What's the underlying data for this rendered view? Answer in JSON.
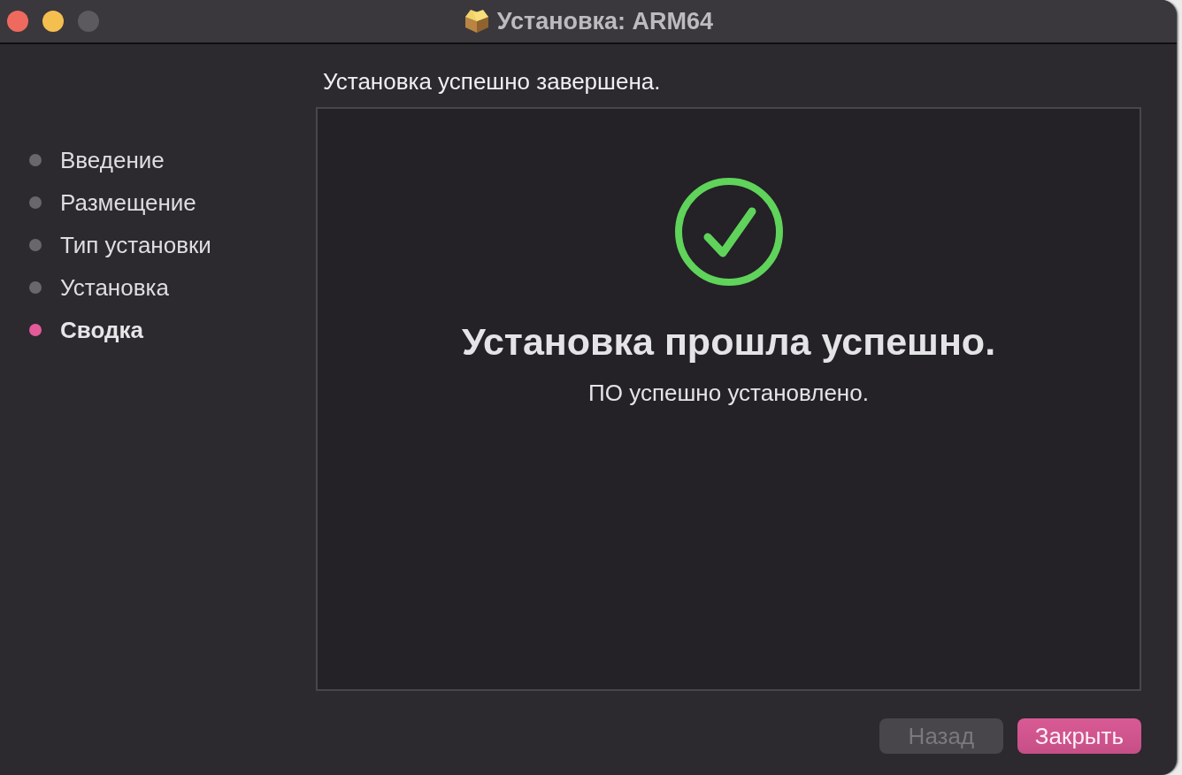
{
  "window": {
    "title": "Установка: ARM64",
    "controls": [
      {
        "kind": "close",
        "disabled": false
      },
      {
        "kind": "minimize",
        "disabled": false
      },
      {
        "kind": "zoom",
        "disabled": true
      }
    ]
  },
  "steps": [
    {
      "label": "Введение",
      "selected": false
    },
    {
      "label": "Размещение",
      "selected": false
    },
    {
      "label": "Тип установки",
      "selected": false
    },
    {
      "label": "Установка",
      "selected": false
    },
    {
      "label": "Сводка",
      "selected": true
    }
  ],
  "heading": "Установка успешно завершена.",
  "result": {
    "title": "Установка прошла успешно.",
    "message": "ПО успешно установлено."
  },
  "buttons": [
    {
      "label": "Назад",
      "kind": "secondary",
      "disabled": true
    },
    {
      "label": "Закрыть",
      "kind": "primary",
      "disabled": false
    }
  ]
}
